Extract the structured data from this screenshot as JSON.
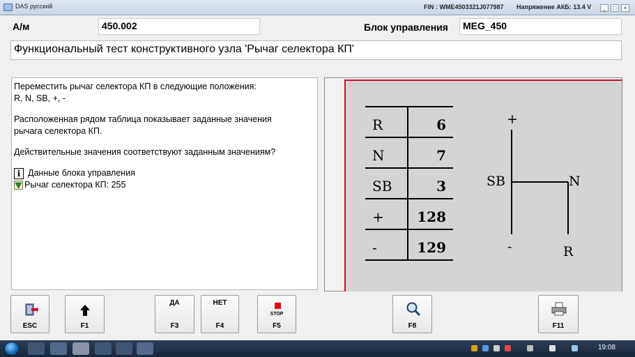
{
  "window": {
    "app_title": "DAS русский",
    "fin": "FIN : WME4503321J077987",
    "battery": "Напряжение АКБ: 13.4 V",
    "controls": [
      "_",
      "□",
      "×"
    ]
  },
  "header": {
    "am_label": "А/м",
    "am_value": "450.002",
    "ecu_label": "Блок управления",
    "ecu_value": "MEG_450",
    "test_title": "Функциональный тест конструктивного узла 'Рычаг селектора КП'"
  },
  "instructions": {
    "line1": "Переместить рычаг селектора КП в следующие положения:",
    "line2": "R, N, SB, +, -",
    "line3": "Расположенная рядом таблица показывает заданные значения",
    "line4": "рычага селектора КП.",
    "line5": "Действительные значения соответствуют заданным значениям?",
    "info_icon_text": "i",
    "ecu_data": "Данные блока управления",
    "selector_value": "Рычаг селектора КП: 255"
  },
  "position_table": [
    {
      "pos": "R",
      "value": "6"
    },
    {
      "pos": "N",
      "value": "7"
    },
    {
      "pos": "SB",
      "value": "3"
    },
    {
      "pos": "+",
      "value": "128"
    },
    {
      "pos": "-",
      "value": "129"
    }
  ],
  "shift_diagram": {
    "plus": "+",
    "sb": "SB",
    "n": "N",
    "minus": "-",
    "r": "R"
  },
  "function_keys": [
    {
      "id": "esc",
      "key": "ESC",
      "top": "",
      "icon": "book-exit-icon"
    },
    {
      "id": "f1",
      "key": "F1",
      "top": "",
      "icon": "up-arrow-icon"
    },
    {
      "id": "f3",
      "key": "F3",
      "top": "ДА",
      "icon": ""
    },
    {
      "id": "f4",
      "key": "F4",
      "top": "НЕТ",
      "icon": ""
    },
    {
      "id": "f5",
      "key": "F5",
      "top": "STOP",
      "icon": "stop-icon"
    },
    {
      "id": "f8",
      "key": "F8",
      "top": "",
      "icon": "magnifier-icon"
    },
    {
      "id": "f11",
      "key": "F11",
      "top": "",
      "icon": "printer-icon"
    }
  ],
  "taskbar": {
    "clock": "19:08"
  },
  "colors": {
    "accent_red": "#c8102e",
    "diagram_bg": "#d4d4d4"
  }
}
